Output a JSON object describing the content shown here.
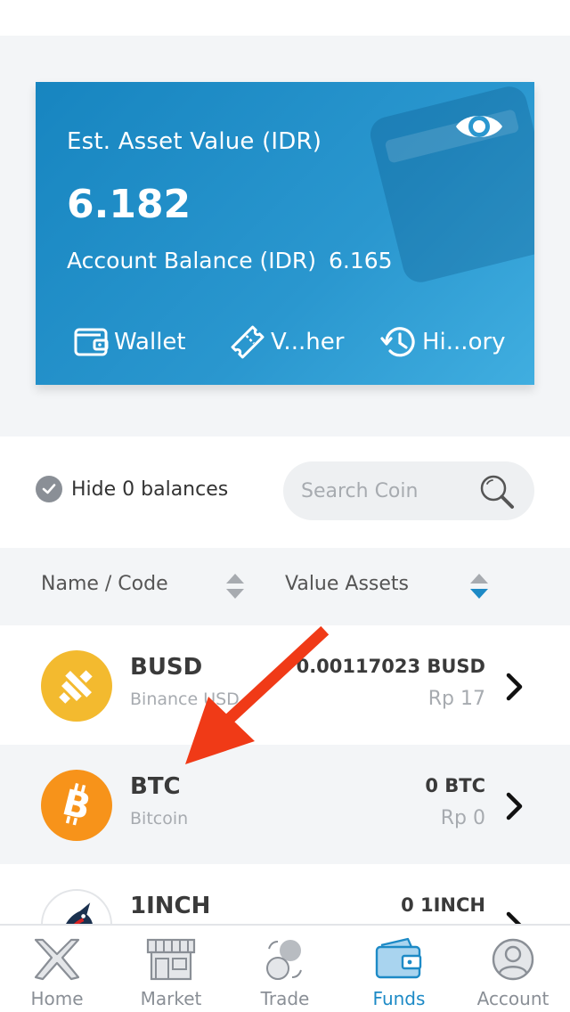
{
  "colors": {
    "accent": "#1d8ac6",
    "card_start": "#1785c0",
    "card_end": "#40aee0",
    "busd": "#f3ba2f",
    "btc": "#f7931a",
    "annotation_arrow": "#f03a17"
  },
  "asset_card": {
    "label": "Est. Asset Value (IDR)",
    "value": "6.182",
    "balance_label": "Account Balance (IDR)",
    "balance_value": "6.165",
    "visibility_icon": "eye-icon",
    "actions": [
      {
        "label": "Wallet",
        "icon": "wallet-icon"
      },
      {
        "label": "V...her",
        "icon": "voucher-icon"
      },
      {
        "label": "Hi...ory",
        "icon": "history-icon"
      }
    ]
  },
  "filters": {
    "hide_zero_label": "Hide 0 balances",
    "hide_zero_checked": true,
    "search_placeholder": "Search Coin",
    "search_value": ""
  },
  "sort_header": {
    "name_label": "Name / Code",
    "value_label": "Value Assets",
    "active_sort": "Value Assets"
  },
  "coins": [
    {
      "code": "BUSD",
      "name": "Binance USD",
      "amount": "0.00117023 BUSD",
      "rp": "Rp 17",
      "logo": "busd-logo"
    },
    {
      "code": "BTC",
      "name": "Bitcoin",
      "amount": "0 BTC",
      "rp": "Rp 0",
      "logo": "btc-logo"
    },
    {
      "code": "1INCH",
      "name": "",
      "amount": "0 1INCH",
      "rp": "",
      "logo": "1inch-logo"
    }
  ],
  "bottom_nav": {
    "active": "Funds",
    "items": [
      {
        "label": "Home",
        "icon": "home-icon"
      },
      {
        "label": "Market",
        "icon": "market-icon"
      },
      {
        "label": "Trade",
        "icon": "trade-icon"
      },
      {
        "label": "Funds",
        "icon": "funds-icon"
      },
      {
        "label": "Account",
        "icon": "account-icon"
      }
    ]
  }
}
